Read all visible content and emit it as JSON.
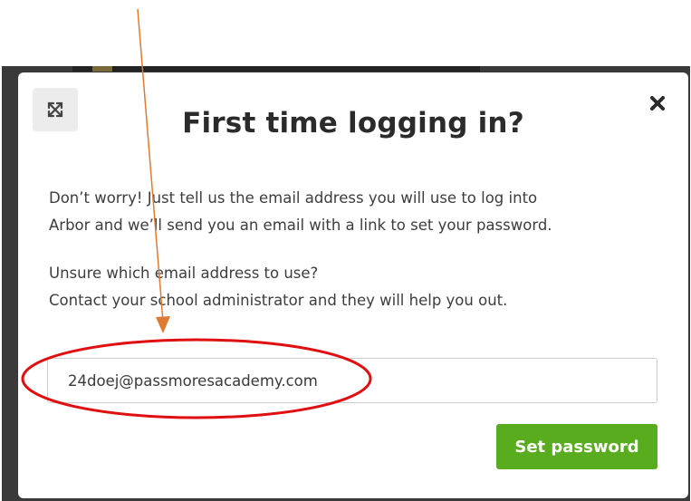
{
  "modal": {
    "title": "First time logging in?",
    "intro_line1": "Don’t worry! Just tell us the email address you will use to log into",
    "intro_line2": "Arbor and we’ll send you an email with a link to set your password.",
    "help_line1": "Unsure which email address to use?",
    "help_line2": "Contact your school administrator and they will help you out.",
    "email_value": "24doej@passmoresacademy.com",
    "submit_label": "Set password",
    "icons": {
      "expand": "expand-icon",
      "close": "close-icon"
    }
  },
  "colors": {
    "primary_button": "#5aac1f",
    "annotation_ellipse": "#e01010",
    "annotation_arrow": "#e07a30"
  }
}
